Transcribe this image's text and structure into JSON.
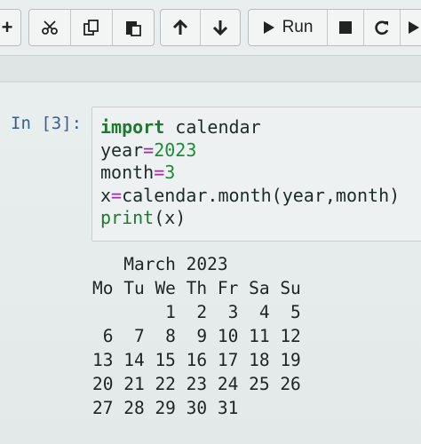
{
  "toolbar": {
    "buttons": {
      "add": "+",
      "run": "Run"
    }
  },
  "cell": {
    "prompt": "In [3]:",
    "code": {
      "line1_kw": "import",
      "line1_rest": " calendar",
      "line2_name": "year",
      "line2_op": "=",
      "line2_val": "2023",
      "line3_name": "month",
      "line3_op": "=",
      "line3_val": "3",
      "line4_name": "x",
      "line4_op": "=",
      "line4_rest": "calendar.month(year,month)",
      "line5_fn": "print",
      "line5_rest": "(x)"
    }
  },
  "output": {
    "lines": [
      "   March 2023",
      "Mo Tu We Th Fr Sa Su",
      "       1  2  3  4  5",
      " 6  7  8  9 10 11 12",
      "13 14 15 16 17 18 19",
      "20 21 22 23 24 25 26",
      "27 28 29 30 31"
    ]
  }
}
